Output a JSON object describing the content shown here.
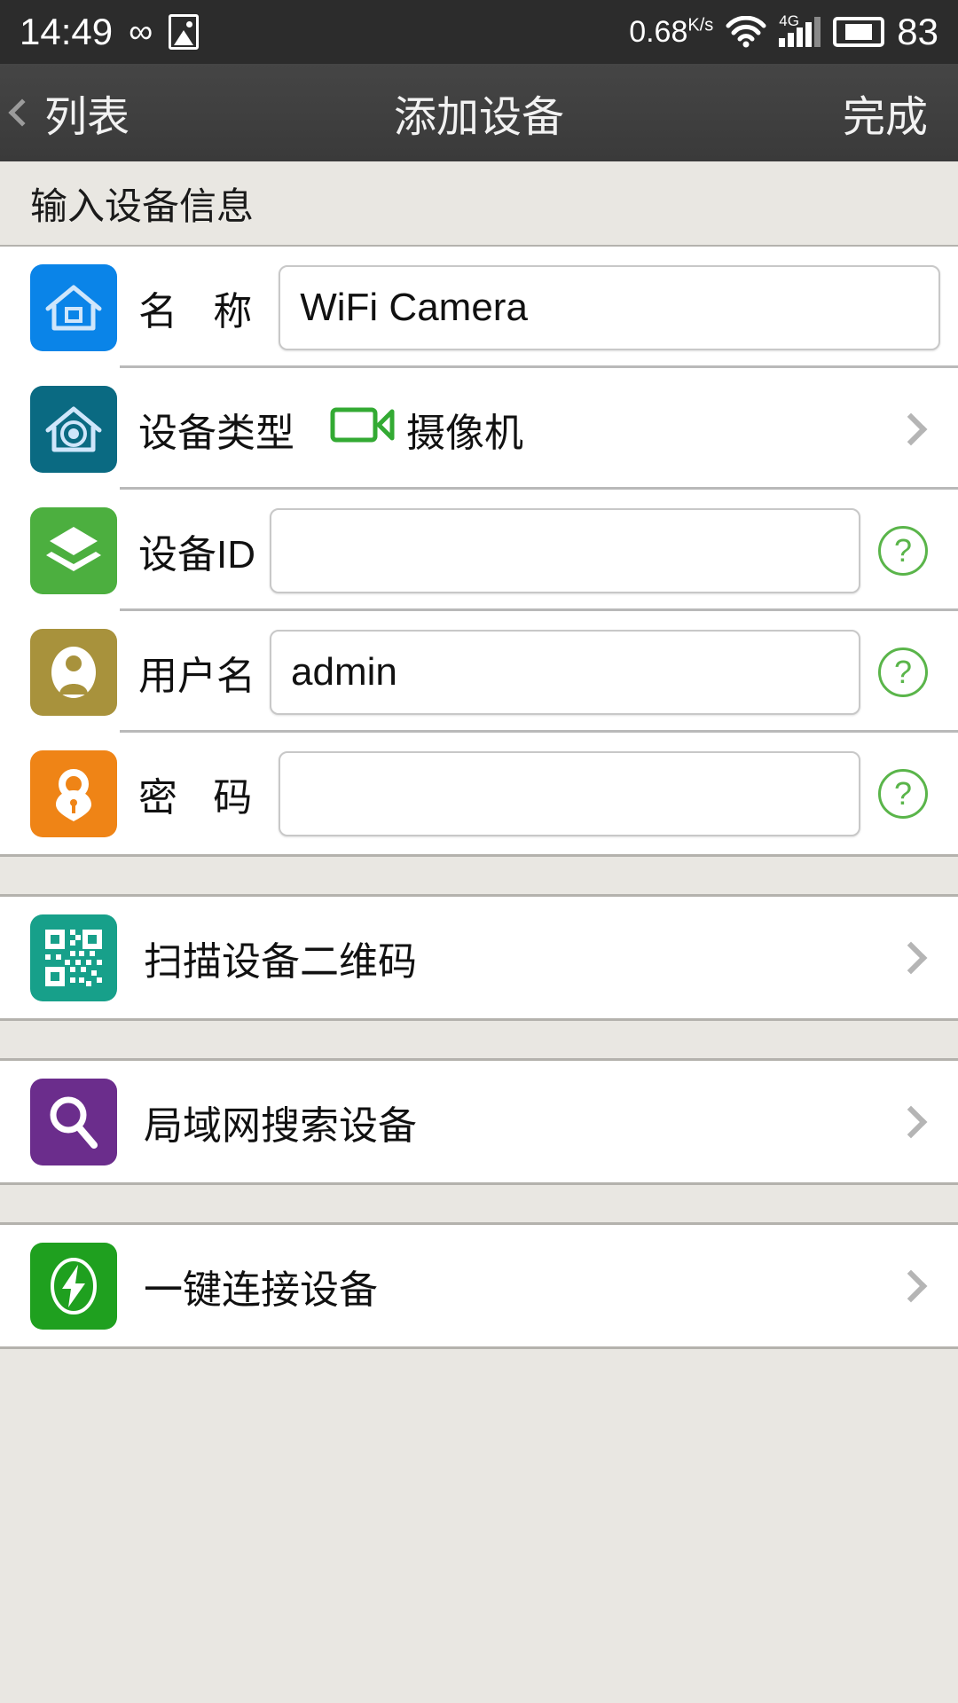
{
  "status_bar": {
    "time": "14:49",
    "infinity_icon": "infinity-icon",
    "gallery_icon": "image-icon",
    "net_speed": "0.68",
    "net_speed_unit": "K/s",
    "wifi_icon": "wifi-icon",
    "network_type": "4G",
    "signal_icon": "signal-bars-icon",
    "battery_icon": "battery-icon",
    "battery_level": "83"
  },
  "nav_bar": {
    "back_label": "列表",
    "back_icon": "chevron-left-icon",
    "title": "添加设备",
    "done_label": "完成"
  },
  "section": {
    "header": "输入设备信息"
  },
  "form": {
    "rows": [
      {
        "key": "name",
        "icon": "home-icon",
        "icon_color": "#0a84e8",
        "label": "名 称",
        "value": "WiFi Camera",
        "placeholder": ""
      },
      {
        "key": "device_type",
        "icon": "home-lens-icon",
        "icon_color": "#0a6a82",
        "label": "设备类型",
        "value": "摄像机",
        "value_icon": "camcorder-icon",
        "value_icon_color": "#33aa33"
      },
      {
        "key": "device_id",
        "icon": "layers-icon",
        "icon_color": "#4caf3f",
        "label": "设备ID",
        "value": "",
        "placeholder": "",
        "help": "?"
      },
      {
        "key": "username",
        "icon": "user-icon",
        "icon_color": "#a8923c",
        "label": "用户名",
        "value": "admin",
        "placeholder": "",
        "help": "?"
      },
      {
        "key": "password",
        "icon": "lock-icon",
        "icon_color": "#ef8416",
        "label": "密 码",
        "value": "",
        "placeholder": "",
        "help": "?"
      }
    ]
  },
  "actions": [
    {
      "key": "scan_qr",
      "icon": "qrcode-icon",
      "icon_color": "#17a08a",
      "label": "扫描设备二维码",
      "chevron": "chevron-right-icon"
    },
    {
      "key": "lan_search",
      "icon": "magnifier-icon",
      "icon_color": "#6b2d8c",
      "label": "局域网搜索设备",
      "chevron": "chevron-right-icon"
    },
    {
      "key": "one_key_connect",
      "icon": "lightning-icon",
      "icon_color": "#1fa01f",
      "label": "一键连接设备",
      "chevron": "chevron-right-icon"
    }
  ],
  "colors": {
    "status_bar_bg": "#2c2c2c",
    "nav_bar_bg": "#3e3e3e",
    "section_bg": "#e9e7e2",
    "accent_green": "#5ab54a"
  }
}
